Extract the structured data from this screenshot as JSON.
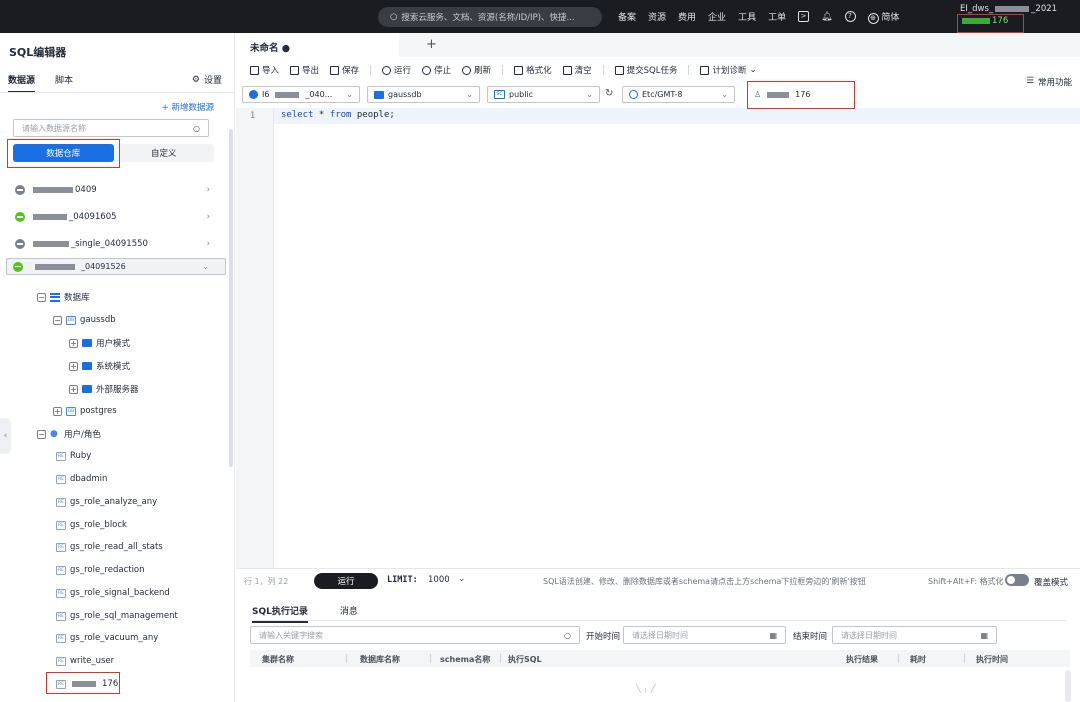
{
  "topbar": {
    "search_placeholder": "搜索云服务、文档、资源(名称/ID/IP)、快捷...",
    "nav": [
      "备案",
      "资源",
      "费用",
      "企业",
      "工具",
      "工单"
    ],
    "language": "简体",
    "account_name": "EI_dws_",
    "account_suffix": "_2021",
    "account_sub": "176"
  },
  "left_panel": {
    "title": "SQL编辑器",
    "tabs": [
      "数据源",
      "脚本"
    ],
    "settings_label": "设置",
    "add_datasource": "+ 新增数据源",
    "search_placeholder": "请输入数据源名称",
    "segments": [
      "数据仓库",
      "自定义"
    ],
    "connections": [
      {
        "label": "0409",
        "status": "gray"
      },
      {
        "label": "_04091605",
        "status": "green"
      },
      {
        "label": "_single_04091550",
        "status": "gray"
      },
      {
        "label": "_04091526",
        "status": "green"
      }
    ],
    "tree": {
      "databases": "数据库",
      "gaussdb": "gaussdb",
      "user_schema": "用户模式",
      "system_schema": "系统模式",
      "foreign_servers": "外部服务器",
      "postgres": "postgres",
      "users_roles": "用户/角色",
      "roles": [
        "Ruby",
        "dbadmin",
        "gs_role_analyze_any",
        "gs_role_block",
        "gs_role_read_all_stats",
        "gs_role_redaction",
        "gs_role_signal_backend",
        "gs_role_sql_management",
        "gs_role_vacuum_any",
        "write_user",
        "176"
      ]
    }
  },
  "editor": {
    "tab_title": "未命名 ●",
    "toolbar": [
      "导入",
      "导出",
      "保存",
      "运行",
      "停止",
      "刷新",
      "格式化",
      "清空",
      "提交SQL任务",
      "计划诊断"
    ],
    "common_functions": "常用功能",
    "selectors": {
      "cluster": "_040...",
      "database": "gaussdb",
      "schema": "public",
      "timezone": "Etc/GMT-8",
      "user": "176"
    },
    "line_number": "1",
    "sql_kw1": "select",
    "sql_rest1": " * ",
    "sql_kw2": "from",
    "sql_rest2": " people;"
  },
  "statusbar": {
    "position": "行 1，列 22",
    "run_label": "运行",
    "limit_label": "LIMIT:",
    "limit_value": "1000",
    "hint": "SQL语法创建、修改、删除数据库或者schema请点击上方schema下拉框旁边的'刷新'按钮",
    "shortcut": "Shift+Alt+F: 格式化",
    "cover_mode": "覆盖模式"
  },
  "results": {
    "tabs": [
      "SQL执行记录",
      "消息"
    ],
    "keyword_placeholder": "请输入关键字搜索",
    "start_label": "开始时间",
    "start_placeholder": "请选择日期时间",
    "end_label": "结束时间",
    "end_placeholder": "请选择日期时间",
    "columns": [
      "集群名称",
      "数据库名称",
      "schema名称",
      "执行SQL",
      "执行结果",
      "耗时",
      "执行时间"
    ]
  },
  "colors": {
    "accent": "#1a6fe4",
    "topbar": "#1b1c21",
    "highlight": "#e0302c"
  }
}
